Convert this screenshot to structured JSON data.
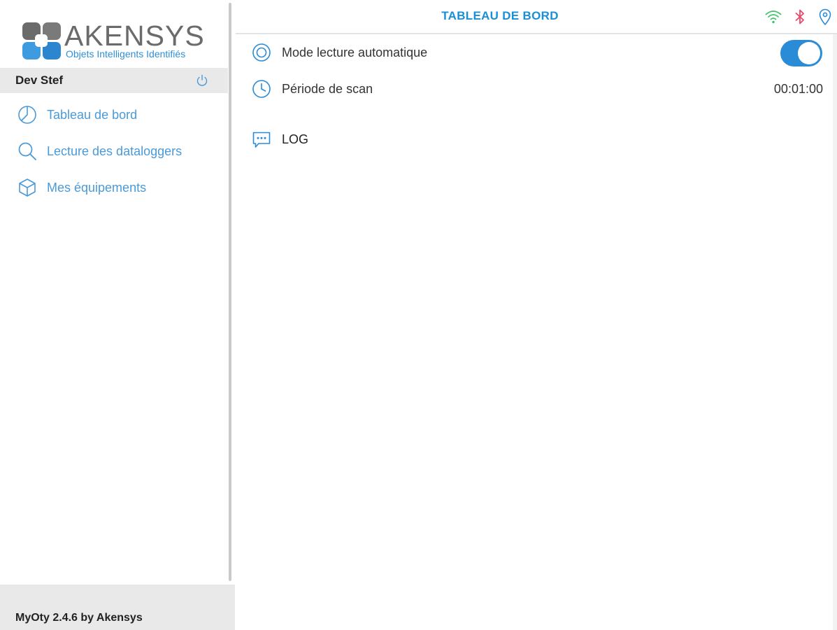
{
  "app": {
    "brand": "AKENSYS",
    "tagline": "Objets Intelligents Identifiés",
    "version_label": "MyOty 2.4.6 by Akensys"
  },
  "user": {
    "name": "Dev Stef",
    "logout_icon": "power-icon"
  },
  "sidebar": {
    "items": [
      {
        "label": "Tableau de bord",
        "icon": "pie-chart-icon"
      },
      {
        "label": "Lecture des dataloggers",
        "icon": "search-icon"
      },
      {
        "label": "Mes équipements",
        "icon": "cube-icon"
      }
    ]
  },
  "header": {
    "title": "TABLEAU DE BORD",
    "status": [
      {
        "icon": "wifi-icon",
        "color": "#3cc468"
      },
      {
        "icon": "bluetooth-icon",
        "color": "#e64a6a"
      },
      {
        "icon": "location-pin-icon",
        "color": "#2a8bd7"
      }
    ]
  },
  "main": {
    "auto_read": {
      "label": "Mode lecture automatique",
      "enabled": true
    },
    "scan_period": {
      "label": "Période de scan",
      "value": "00:01:00"
    },
    "log": {
      "label": "LOG"
    }
  },
  "colors": {
    "accent": "#2a8bd7",
    "nav_text": "#4a9ad8",
    "panel_gray": "#e9e9e9"
  }
}
